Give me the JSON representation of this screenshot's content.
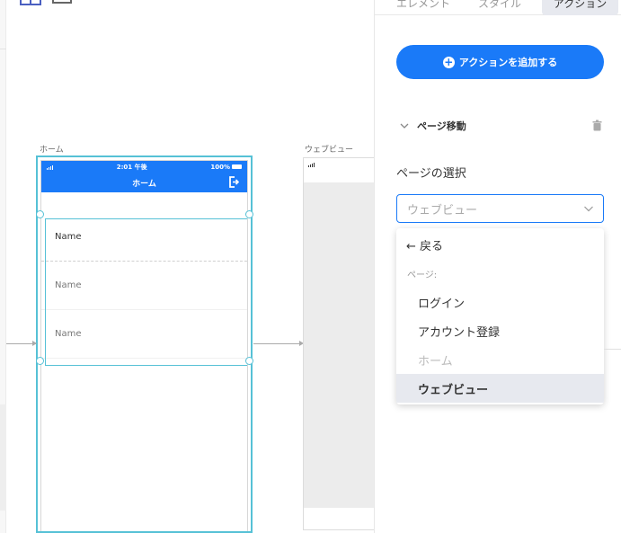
{
  "panel": {
    "tabs": [
      {
        "label": "エレメント"
      },
      {
        "label": "スタイル"
      },
      {
        "label": "アクション"
      }
    ],
    "add_action_label": "アクションを追加する",
    "section_title": "ページ移動",
    "field_label": "ページの選択",
    "select": {
      "placeholder": "ウェブビュー"
    },
    "dropdown": {
      "back_label": "← 戻る",
      "group_label": "ページ:",
      "options": [
        {
          "label": "ログイン",
          "state": "normal"
        },
        {
          "label": "アカウント登録",
          "state": "normal"
        },
        {
          "label": "ホーム",
          "state": "disabled"
        },
        {
          "label": "ウェブビュー",
          "state": "selected"
        }
      ]
    }
  },
  "canvas": {
    "screens": [
      {
        "label": "ホーム",
        "status_time": "2:01 午後",
        "status_battery": "100%",
        "nav_title": "ホーム",
        "list_items": [
          "Name",
          "Name",
          "Name"
        ]
      },
      {
        "label": "ウェブビュー"
      }
    ]
  },
  "colors": {
    "accent": "#1a7af8",
    "selection": "#56c1d6",
    "tab_active_bg": "#e7e9ef"
  },
  "icons": {
    "add": "plus-circle-icon",
    "collapse": "chevron-down-icon",
    "delete": "trash-icon",
    "select_caret": "chevron-down-icon",
    "logout": "logout-icon"
  }
}
